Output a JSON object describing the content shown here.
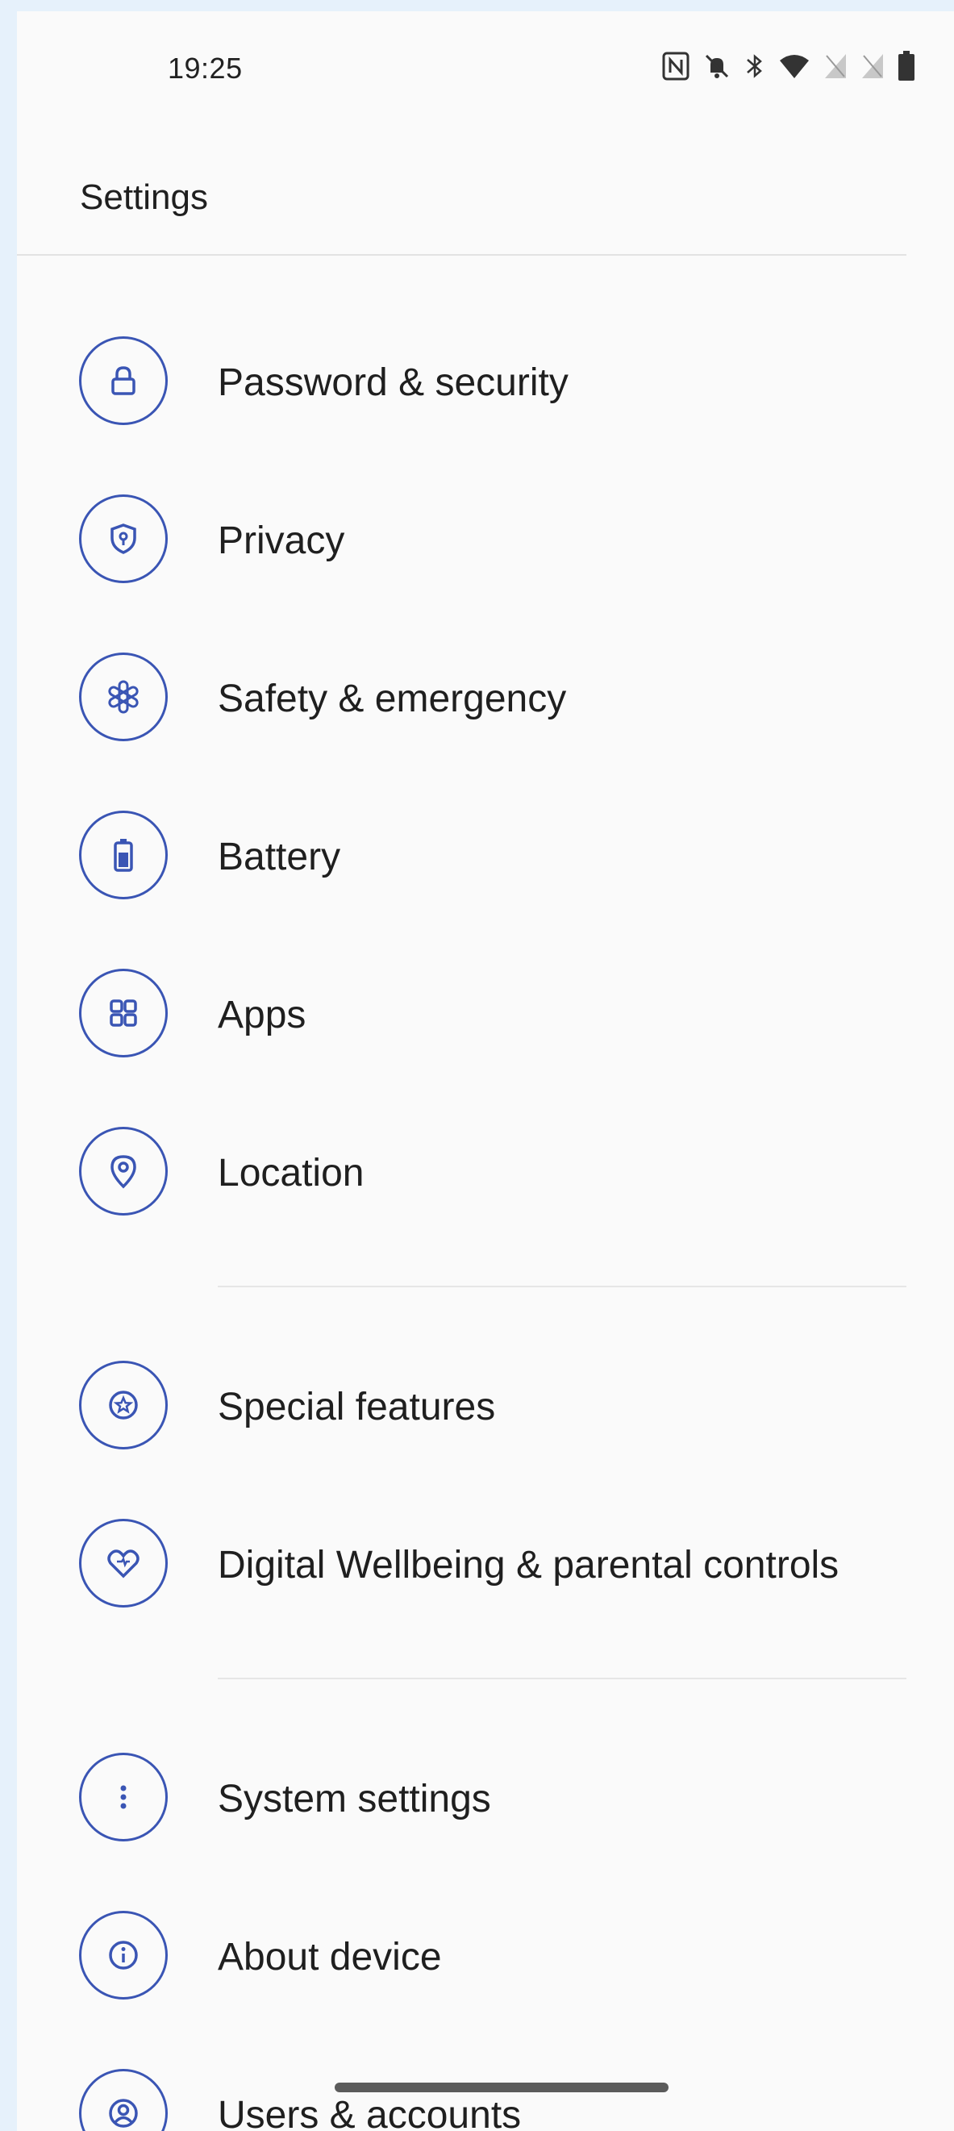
{
  "status_bar": {
    "time": "19:25",
    "icons": [
      "nfc-icon",
      "notifications-muted-icon",
      "bluetooth-icon",
      "wifi-icon",
      "sim-1-no-signal-icon",
      "sim-2-no-signal-icon",
      "battery-icon"
    ]
  },
  "header": {
    "title": "Settings"
  },
  "items": [
    {
      "label": "Password & security",
      "icon": "lock-icon"
    },
    {
      "label": "Privacy",
      "icon": "privacy-shield-icon"
    },
    {
      "label": "Safety & emergency",
      "icon": "emergency-asterisk-icon"
    },
    {
      "label": "Battery",
      "icon": "battery-icon"
    },
    {
      "label": "Apps",
      "icon": "apps-grid-icon"
    },
    {
      "label": "Location",
      "icon": "location-pin-icon"
    },
    {
      "label": "Special features",
      "icon": "star-badge-icon"
    },
    {
      "label": "Digital Wellbeing & parental controls",
      "icon": "heart-icon"
    },
    {
      "label": "System settings",
      "icon": "more-vertical-icon"
    },
    {
      "label": "About device",
      "icon": "info-icon"
    },
    {
      "label": "Users & accounts",
      "icon": "user-account-icon"
    }
  ],
  "colors": {
    "accent": "#3a55b4",
    "background": "#fafafa",
    "outer_background": "#e6f1fb",
    "text": "#1f1f1f"
  }
}
